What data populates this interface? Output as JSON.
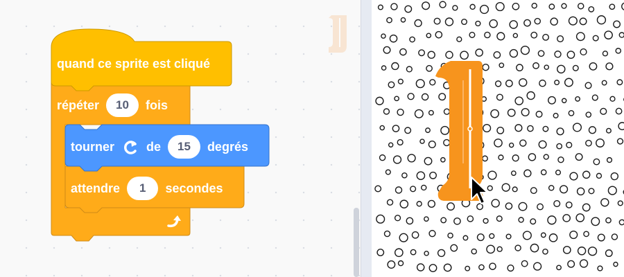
{
  "workspace": {
    "hat_block": {
      "label": "quand ce sprite est cliqué"
    },
    "repeat_block": {
      "label_before": "répéter",
      "count": "10",
      "label_after": "fois"
    },
    "turn_block": {
      "label_before": "tourner",
      "direction_icon": "rotate-clockwise-icon",
      "label_mid": "de",
      "degrees": "15",
      "label_after": "degrés"
    },
    "wait_block": {
      "label_before": "attendre",
      "seconds": "1",
      "label_after": "secondes"
    },
    "loop_icon": "loop-arrow-icon"
  },
  "colors": {
    "events": "#ffbf00",
    "control": "#ffab19",
    "motion": "#4c97ff",
    "sprite": "#f7941d"
  },
  "stage": {
    "sprite_icon": "letter-l-sprite-icon",
    "cursor_icon": "mouse-pointer-icon"
  }
}
